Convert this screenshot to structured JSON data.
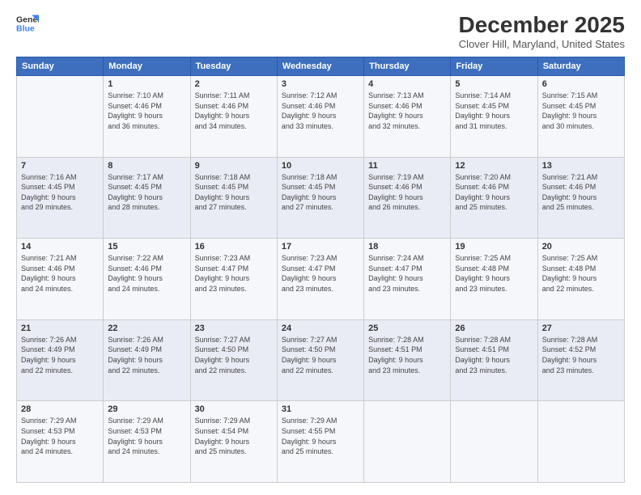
{
  "header": {
    "logo_line1": "General",
    "logo_line2": "Blue",
    "title": "December 2025",
    "subtitle": "Clover Hill, Maryland, United States"
  },
  "days_of_week": [
    "Sunday",
    "Monday",
    "Tuesday",
    "Wednesday",
    "Thursday",
    "Friday",
    "Saturday"
  ],
  "weeks": [
    [
      {
        "day": "",
        "info": ""
      },
      {
        "day": "1",
        "info": "Sunrise: 7:10 AM\nSunset: 4:46 PM\nDaylight: 9 hours\nand 36 minutes."
      },
      {
        "day": "2",
        "info": "Sunrise: 7:11 AM\nSunset: 4:46 PM\nDaylight: 9 hours\nand 34 minutes."
      },
      {
        "day": "3",
        "info": "Sunrise: 7:12 AM\nSunset: 4:46 PM\nDaylight: 9 hours\nand 33 minutes."
      },
      {
        "day": "4",
        "info": "Sunrise: 7:13 AM\nSunset: 4:46 PM\nDaylight: 9 hours\nand 32 minutes."
      },
      {
        "day": "5",
        "info": "Sunrise: 7:14 AM\nSunset: 4:45 PM\nDaylight: 9 hours\nand 31 minutes."
      },
      {
        "day": "6",
        "info": "Sunrise: 7:15 AM\nSunset: 4:45 PM\nDaylight: 9 hours\nand 30 minutes."
      }
    ],
    [
      {
        "day": "7",
        "info": "Sunrise: 7:16 AM\nSunset: 4:45 PM\nDaylight: 9 hours\nand 29 minutes."
      },
      {
        "day": "8",
        "info": "Sunrise: 7:17 AM\nSunset: 4:45 PM\nDaylight: 9 hours\nand 28 minutes."
      },
      {
        "day": "9",
        "info": "Sunrise: 7:18 AM\nSunset: 4:45 PM\nDaylight: 9 hours\nand 27 minutes."
      },
      {
        "day": "10",
        "info": "Sunrise: 7:18 AM\nSunset: 4:45 PM\nDaylight: 9 hours\nand 27 minutes."
      },
      {
        "day": "11",
        "info": "Sunrise: 7:19 AM\nSunset: 4:46 PM\nDaylight: 9 hours\nand 26 minutes."
      },
      {
        "day": "12",
        "info": "Sunrise: 7:20 AM\nSunset: 4:46 PM\nDaylight: 9 hours\nand 25 minutes."
      },
      {
        "day": "13",
        "info": "Sunrise: 7:21 AM\nSunset: 4:46 PM\nDaylight: 9 hours\nand 25 minutes."
      }
    ],
    [
      {
        "day": "14",
        "info": "Sunrise: 7:21 AM\nSunset: 4:46 PM\nDaylight: 9 hours\nand 24 minutes."
      },
      {
        "day": "15",
        "info": "Sunrise: 7:22 AM\nSunset: 4:46 PM\nDaylight: 9 hours\nand 24 minutes."
      },
      {
        "day": "16",
        "info": "Sunrise: 7:23 AM\nSunset: 4:47 PM\nDaylight: 9 hours\nand 23 minutes."
      },
      {
        "day": "17",
        "info": "Sunrise: 7:23 AM\nSunset: 4:47 PM\nDaylight: 9 hours\nand 23 minutes."
      },
      {
        "day": "18",
        "info": "Sunrise: 7:24 AM\nSunset: 4:47 PM\nDaylight: 9 hours\nand 23 minutes."
      },
      {
        "day": "19",
        "info": "Sunrise: 7:25 AM\nSunset: 4:48 PM\nDaylight: 9 hours\nand 23 minutes."
      },
      {
        "day": "20",
        "info": "Sunrise: 7:25 AM\nSunset: 4:48 PM\nDaylight: 9 hours\nand 22 minutes."
      }
    ],
    [
      {
        "day": "21",
        "info": "Sunrise: 7:26 AM\nSunset: 4:49 PM\nDaylight: 9 hours\nand 22 minutes."
      },
      {
        "day": "22",
        "info": "Sunrise: 7:26 AM\nSunset: 4:49 PM\nDaylight: 9 hours\nand 22 minutes."
      },
      {
        "day": "23",
        "info": "Sunrise: 7:27 AM\nSunset: 4:50 PM\nDaylight: 9 hours\nand 22 minutes."
      },
      {
        "day": "24",
        "info": "Sunrise: 7:27 AM\nSunset: 4:50 PM\nDaylight: 9 hours\nand 22 minutes."
      },
      {
        "day": "25",
        "info": "Sunrise: 7:28 AM\nSunset: 4:51 PM\nDaylight: 9 hours\nand 23 minutes."
      },
      {
        "day": "26",
        "info": "Sunrise: 7:28 AM\nSunset: 4:51 PM\nDaylight: 9 hours\nand 23 minutes."
      },
      {
        "day": "27",
        "info": "Sunrise: 7:28 AM\nSunset: 4:52 PM\nDaylight: 9 hours\nand 23 minutes."
      }
    ],
    [
      {
        "day": "28",
        "info": "Sunrise: 7:29 AM\nSunset: 4:53 PM\nDaylight: 9 hours\nand 24 minutes."
      },
      {
        "day": "29",
        "info": "Sunrise: 7:29 AM\nSunset: 4:53 PM\nDaylight: 9 hours\nand 24 minutes."
      },
      {
        "day": "30",
        "info": "Sunrise: 7:29 AM\nSunset: 4:54 PM\nDaylight: 9 hours\nand 25 minutes."
      },
      {
        "day": "31",
        "info": "Sunrise: 7:29 AM\nSunset: 4:55 PM\nDaylight: 9 hours\nand 25 minutes."
      },
      {
        "day": "",
        "info": ""
      },
      {
        "day": "",
        "info": ""
      },
      {
        "day": "",
        "info": ""
      }
    ]
  ]
}
